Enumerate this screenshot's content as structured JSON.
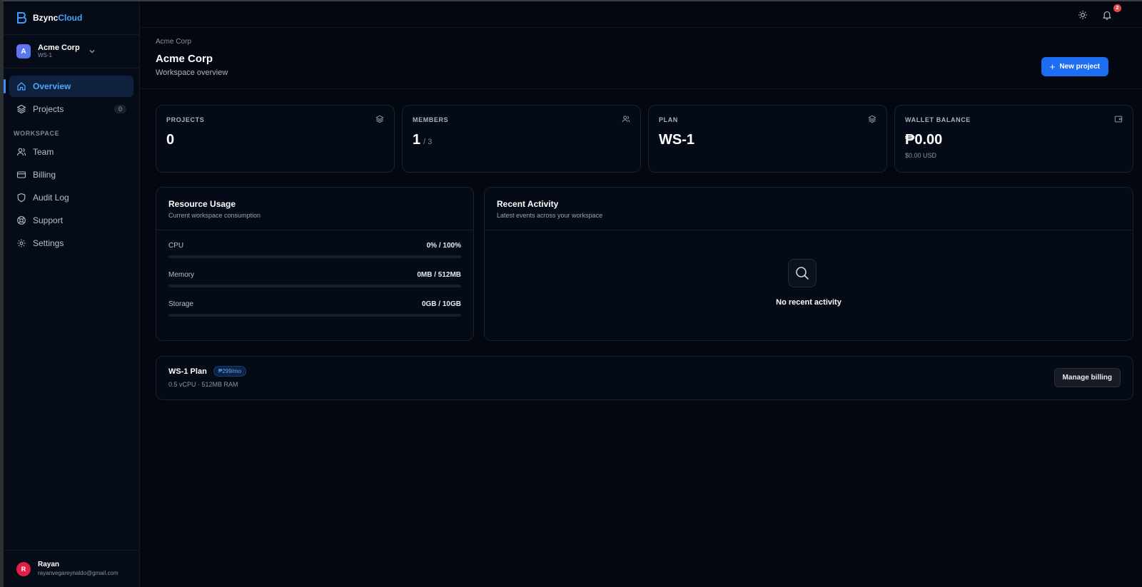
{
  "brand": {
    "name_part1": "Bzync",
    "name_part2": "Cloud",
    "logo_icon": "b-logo-icon",
    "accent_color": "#4aa3ff"
  },
  "workspace_switcher": {
    "initial": "A",
    "name": "Acme Corp",
    "id": "WS-1",
    "chevron_icon": "chevron-down-icon"
  },
  "sidebar": {
    "items": [
      {
        "label": "Overview",
        "icon": "home-icon",
        "active": true
      },
      {
        "label": "Projects",
        "icon": "layers-icon",
        "badge": "0"
      }
    ],
    "section_label": "WORKSPACE",
    "workspace_items": [
      {
        "label": "Team",
        "icon": "users-icon"
      },
      {
        "label": "Billing",
        "icon": "credit-card-icon"
      },
      {
        "label": "Audit Log",
        "icon": "shield-icon"
      },
      {
        "label": "Support",
        "icon": "life-buoy-icon"
      },
      {
        "label": "Settings",
        "icon": "gear-icon"
      }
    ]
  },
  "user": {
    "initial": "R",
    "name": "Rayan",
    "email": "rayanvegareynaldo@gmail.com"
  },
  "topbar": {
    "theme_icon": "sun-icon",
    "notification_icon": "bell-icon",
    "notification_count": "2"
  },
  "header": {
    "breadcrumb": "Acme Corp",
    "title": "Acme Corp",
    "subtitle": "Workspace overview",
    "new_project_label": "New project"
  },
  "stats": [
    {
      "label": "PROJECTS",
      "value": "0",
      "icon": "layers-icon"
    },
    {
      "label": "MEMBERS",
      "value": "1",
      "suffix": "/ 3",
      "icon": "users-icon"
    },
    {
      "label": "PLAN",
      "value": "WS-1",
      "icon": "layers-icon"
    },
    {
      "label": "WALLET BALANCE",
      "value": "₱0.00",
      "sub": "$0.00 USD",
      "icon": "wallet-icon"
    }
  ],
  "resource_usage": {
    "title": "Resource Usage",
    "subtitle": "Current workspace consumption",
    "rows": [
      {
        "label": "CPU",
        "value": "0% / 100%",
        "fraction": 0
      },
      {
        "label": "Memory",
        "value": "0MB / 512MB",
        "fraction": 0
      },
      {
        "label": "Storage",
        "value": "0GB / 10GB",
        "fraction": 0
      }
    ]
  },
  "recent_activity": {
    "title": "Recent Activity",
    "subtitle": "Latest events across your workspace",
    "empty_icon": "search-icon",
    "empty_text": "No recent activity"
  },
  "plan": {
    "title": "WS-1 Plan",
    "price_badge": "₱299/mo",
    "specs": "0.5 vCPU · 512MB RAM",
    "manage_label": "Manage billing"
  }
}
